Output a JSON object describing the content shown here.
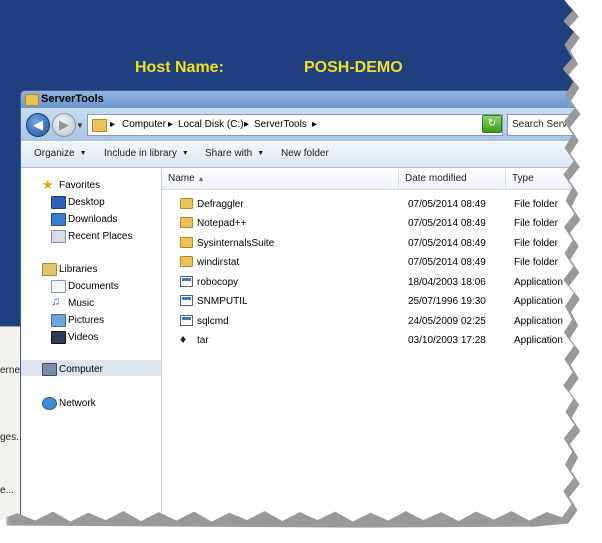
{
  "banner": {
    "label": "Host Name:",
    "value": "POSH-DEMO"
  },
  "background_window": {
    "fragments": [
      "ernet",
      "ges.",
      "e..."
    ]
  },
  "window": {
    "title": "ServerTools",
    "address": {
      "breadcrumbs": [
        "Computer",
        "Local Disk (C:)",
        "ServerTools"
      ]
    },
    "search_placeholder": "Search Serv",
    "toolbar": {
      "organize": "Organize",
      "include_in_library": "Include in library",
      "share_with": "Share with",
      "new_folder": "New folder"
    },
    "nav": {
      "favorites": {
        "label": "Favorites",
        "items": [
          "Desktop",
          "Downloads",
          "Recent Places"
        ]
      },
      "libraries": {
        "label": "Libraries",
        "items": [
          "Documents",
          "Music",
          "Pictures",
          "Videos"
        ]
      },
      "computer": "Computer",
      "network": "Network"
    },
    "columns": {
      "name": "Name",
      "date": "Date modified",
      "type": "Type"
    },
    "files": [
      {
        "name": "Defraggler",
        "date": "07/05/2014 08:49",
        "type": "File folder",
        "icon": "folder-icon"
      },
      {
        "name": "Notepad++",
        "date": "07/05/2014 08:49",
        "type": "File folder",
        "icon": "folder-icon"
      },
      {
        "name": "SysinternalsSuite",
        "date": "07/05/2014 08:49",
        "type": "File folder",
        "icon": "folder-icon"
      },
      {
        "name": "windirstat",
        "date": "07/05/2014 08:49",
        "type": "File folder",
        "icon": "folder-icon"
      },
      {
        "name": "robocopy",
        "date": "18/04/2003 18:06",
        "type": "Application",
        "icon": "application-icon"
      },
      {
        "name": "SNMPUTIL",
        "date": "25/07/1996 19:30",
        "type": "Application",
        "icon": "application-icon"
      },
      {
        "name": "sqlcmd",
        "date": "24/05/2009 02:25",
        "type": "Application",
        "icon": "application-icon"
      },
      {
        "name": "tar",
        "date": "03/10/2003 17:28",
        "type": "Application",
        "icon": "gnu-tar-icon"
      }
    ]
  },
  "colors": {
    "desktop": "#1f3f7f",
    "banner_text": "#f0e020",
    "window_chrome": "#6f9ad0"
  }
}
